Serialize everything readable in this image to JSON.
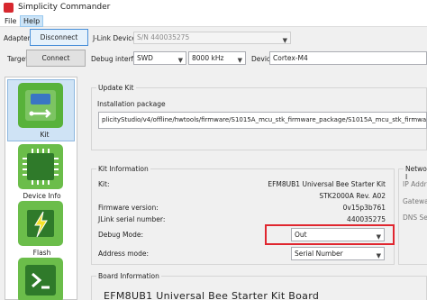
{
  "window": {
    "title": "Simplicity Commander"
  },
  "menu": [
    "File",
    "Help"
  ],
  "toolbar": {
    "adapter_label": "Adapter",
    "disconnect_label": "Disconnect",
    "jlink_label": "J-Link Device",
    "jlink_value": "S/N 440035275",
    "target_label": "Target",
    "connect_label": "Connect",
    "debug_iface_label": "Debug interface",
    "debug_iface_value": "SWD",
    "speed_value": "8000 kHz",
    "device_label": "Device",
    "device_value": "Cortex-M4"
  },
  "sidebar": [
    {
      "label": "Kit",
      "icon": "usb-board-icon"
    },
    {
      "label": "Device Info",
      "icon": "chip-icon"
    },
    {
      "label": "Flash",
      "icon": "flash-chip-icon"
    },
    {
      "label": "",
      "icon": "terminal-icon"
    }
  ],
  "update_kit": {
    "title": "Update Kit",
    "package_label": "Installation package",
    "package_path": "plicityStudio/v4/offline/hwtools/firmware/S1015A_mcu_stk_firmware_package/S1015A_mcu_stk_firmware_package_0v15b"
  },
  "kit_info": {
    "title": "Kit Information",
    "rows": [
      {
        "label": "Kit:",
        "value": "EFM8UB1 Universal Bee Starter Kit"
      },
      {
        "label": "",
        "value": "STK2000A Rev. A02"
      },
      {
        "label": "Firmware version:",
        "value": "0v15p3b761"
      },
      {
        "label": "JLink serial number:",
        "value": "440035275"
      }
    ],
    "debug_mode_label": "Debug Mode:",
    "debug_mode_value": "Out",
    "address_mode_label": "Address mode:",
    "address_mode_value": "Serial Number"
  },
  "network": {
    "title": "Network I",
    "rows": [
      "IP Addre",
      "Gateway",
      "DNS Serv"
    ]
  },
  "board_info": {
    "title": "Board Information",
    "board_name": "EFM8UB1 Universal Bee Starter Kit Board"
  },
  "colors": {
    "highlight": "#e0262f",
    "accent": "#4a90d9"
  }
}
